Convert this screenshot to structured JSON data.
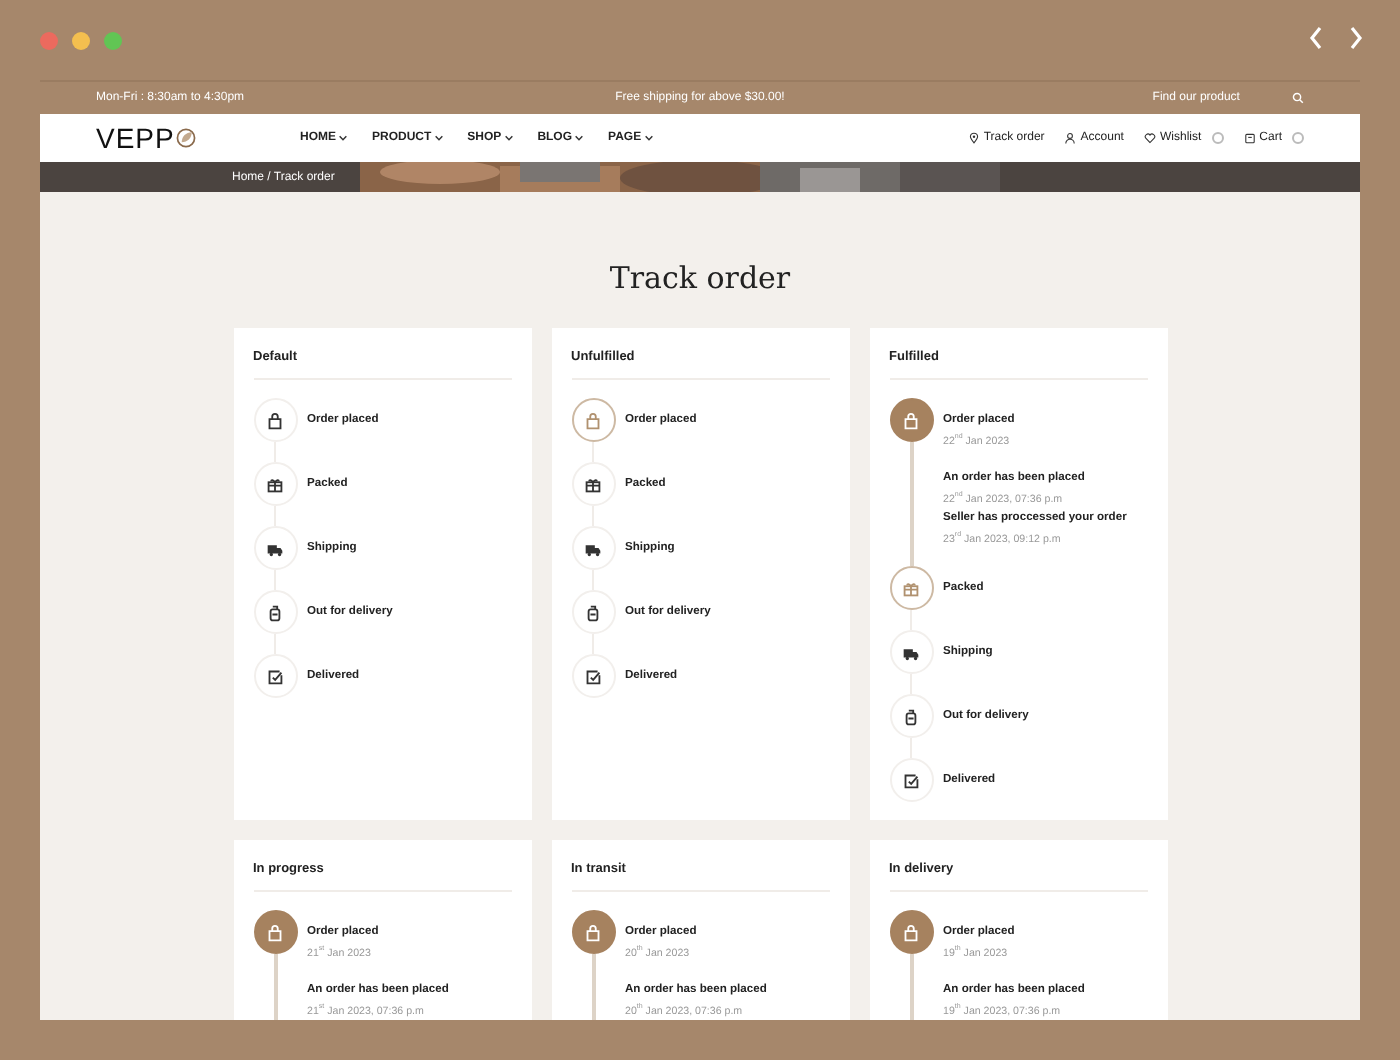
{
  "topbar": {
    "hours": "Mon-Fri : 8:30am to 4:30pm",
    "promo": "Free shipping for above $30.00!",
    "search_label": "Find our product"
  },
  "nav": {
    "logo": "VEPP",
    "menu": [
      {
        "label": "HOME"
      },
      {
        "label": "PRODUCT"
      },
      {
        "label": "SHOP"
      },
      {
        "label": "BLOG"
      },
      {
        "label": "PAGE"
      }
    ],
    "links": [
      {
        "kind": "pin",
        "label": "Track order"
      },
      {
        "kind": "user",
        "label": "Account"
      },
      {
        "kind": "heart",
        "label": "Wishlist",
        "badge": true
      },
      {
        "kind": "cart",
        "label": "Cart",
        "badge": true
      }
    ]
  },
  "breadcrumb": "Home / Track order",
  "page_title": "Track order",
  "cards": [
    {
      "title": "Default",
      "steps": [
        {
          "kind": "bag",
          "label": "Order placed",
          "done": false,
          "current": false
        },
        {
          "kind": "gift",
          "label": "Packed",
          "done": false,
          "current": false
        },
        {
          "kind": "truck",
          "label": "Shipping",
          "done": false,
          "current": false
        },
        {
          "kind": "bottle",
          "label": "Out for delivery",
          "done": false,
          "current": false
        },
        {
          "kind": "check",
          "label": "Delivered",
          "done": false,
          "current": false
        }
      ]
    },
    {
      "title": "Unfulfilled",
      "steps": [
        {
          "kind": "bag",
          "label": "Order placed",
          "done": false,
          "current": true
        },
        {
          "kind": "gift",
          "label": "Packed",
          "done": false,
          "current": false
        },
        {
          "kind": "truck",
          "label": "Shipping",
          "done": false,
          "current": false
        },
        {
          "kind": "bottle",
          "label": "Out for delivery",
          "done": false,
          "current": false
        },
        {
          "kind": "check",
          "label": "Delivered",
          "done": false,
          "current": false
        }
      ]
    },
    {
      "title": "Fulfilled",
      "steps": [
        {
          "kind": "bag",
          "label": "Order placed",
          "done": true,
          "current": false,
          "date": "22$^{nd}$ Jan 2023",
          "events": [
            {
              "text": "An order has been placed",
              "date": "22$^{nd}$ Jan 2023, 07:36 p.m"
            },
            {
              "text": "Seller has proccessed your order",
              "date": "23$^{rd}$ Jan 2023, 09:12 p.m"
            }
          ]
        },
        {
          "kind": "gift",
          "label": "Packed",
          "done": false,
          "current": true
        },
        {
          "kind": "truck",
          "label": "Shipping",
          "done": false,
          "current": false
        },
        {
          "kind": "bottle",
          "label": "Out for delivery",
          "done": false,
          "current": false
        },
        {
          "kind": "check",
          "label": "Delivered",
          "done": false,
          "current": false
        }
      ]
    },
    {
      "title": "In progress",
      "steps": [
        {
          "kind": "bag",
          "label": "Order placed",
          "done": true,
          "current": false,
          "date": "21$^{st}$ Jan 2023",
          "events": [
            {
              "text": "An order has been placed",
              "date": "21$^{st}$ Jan 2023, 07:36 p.m"
            }
          ]
        }
      ]
    },
    {
      "title": "In transit",
      "steps": [
        {
          "kind": "bag",
          "label": "Order placed",
          "done": true,
          "current": false,
          "date": "20$^{th}$ Jan 2023",
          "events": [
            {
              "text": "An order has been placed",
              "date": "20$^{th}$ Jan 2023, 07:36 p.m"
            }
          ]
        }
      ]
    },
    {
      "title": "In delivery",
      "steps": [
        {
          "kind": "bag",
          "label": "Order placed",
          "done": true,
          "current": false,
          "date": "19$^{th}$ Jan 2023",
          "events": [
            {
              "text": "An order has been placed",
              "date": "19$^{th}$ Jan 2023, 07:36 p.m"
            }
          ]
        }
      ]
    }
  ]
}
